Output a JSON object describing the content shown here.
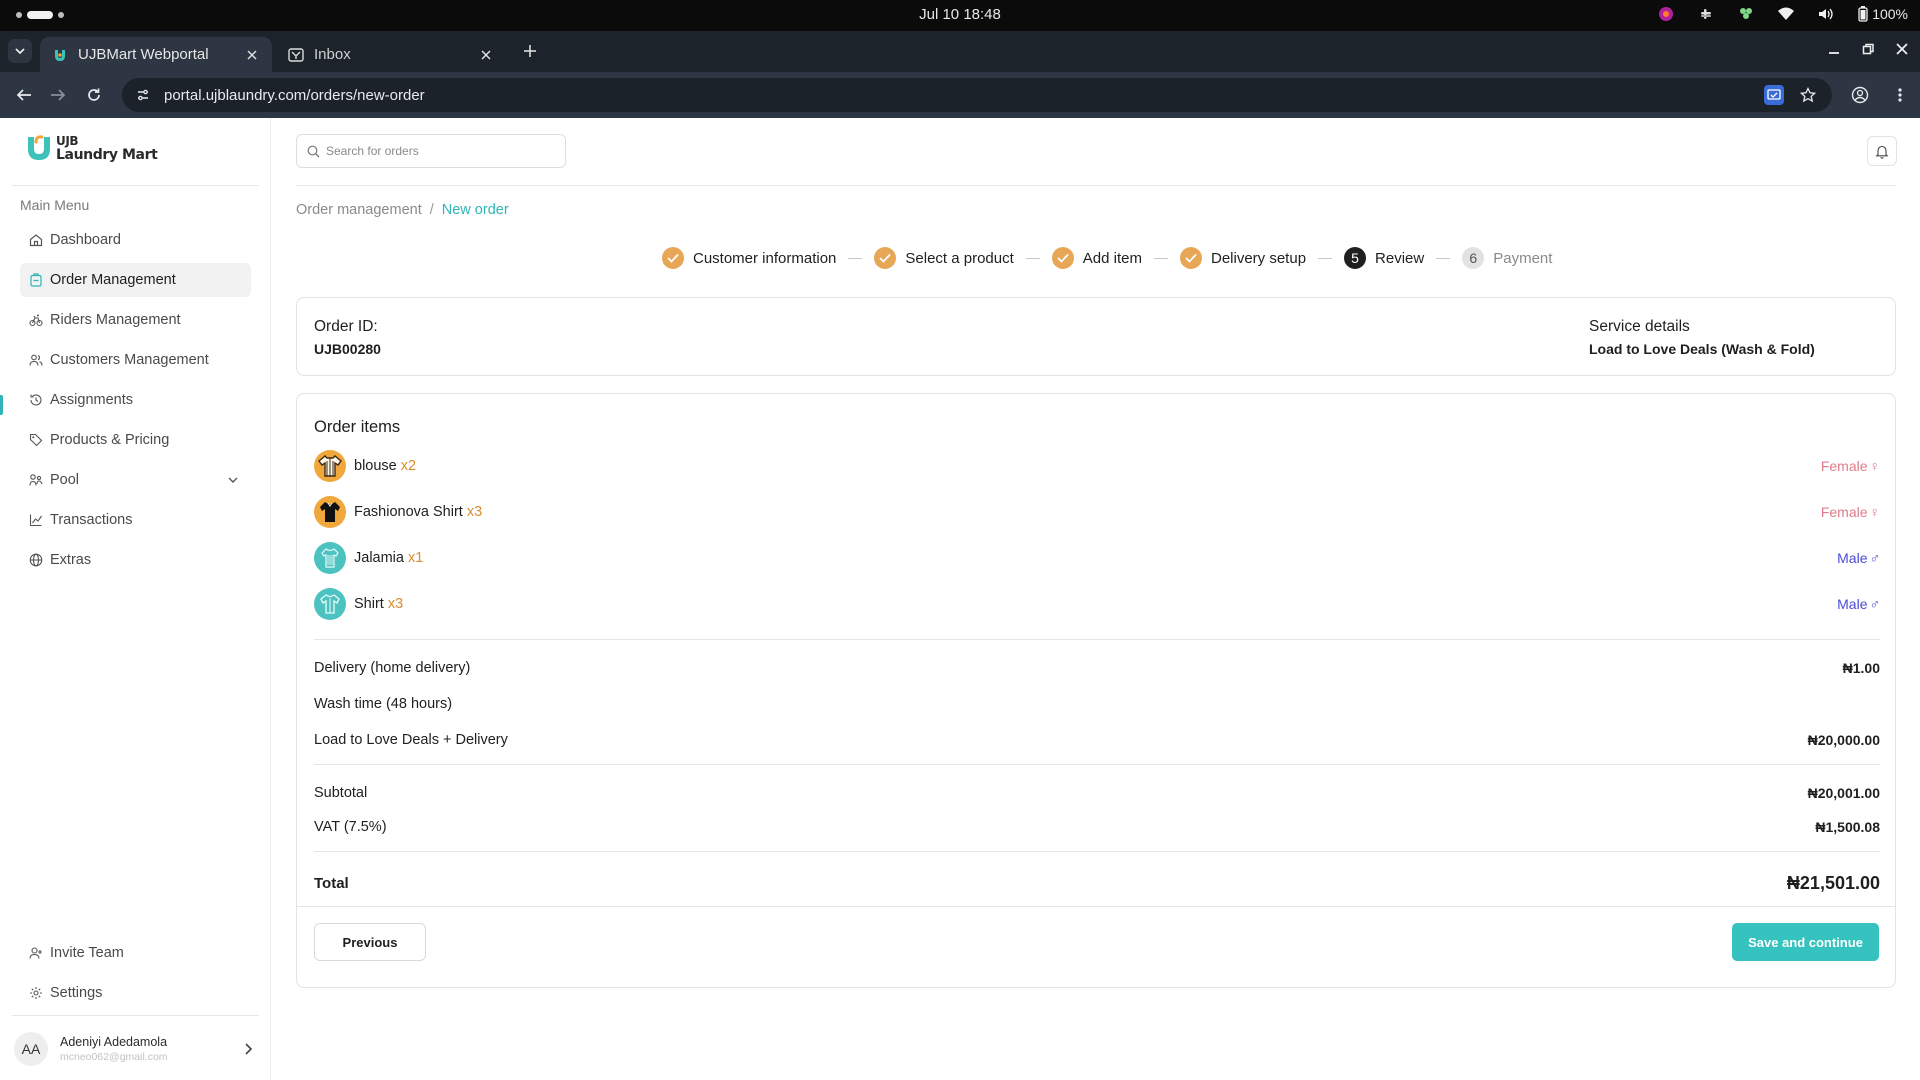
{
  "os": {
    "clock": "Jul 10  18:48",
    "battery": "100%"
  },
  "browser": {
    "tabs": [
      {
        "title": "UJBMart Webportal",
        "active": true
      },
      {
        "title": "Inbox",
        "active": false
      }
    ],
    "url": "portal.ujblaundry.com/orders/new-order"
  },
  "sidebar": {
    "logo": {
      "line1": "UJB",
      "line2": "Laundry Mart"
    },
    "menu_heading": "Main Menu",
    "items": [
      {
        "label": "Dashboard",
        "icon": "home-icon"
      },
      {
        "label": "Order Management",
        "icon": "clipboard-icon",
        "active": true
      },
      {
        "label": "Riders Management",
        "icon": "bike-icon"
      },
      {
        "label": "Customers Management",
        "icon": "users-icon"
      },
      {
        "label": "Assignments",
        "icon": "history-icon"
      },
      {
        "label": "Products & Pricing",
        "icon": "tag-icon"
      },
      {
        "label": "Pool",
        "icon": "pool-icon"
      },
      {
        "label": "Transactions",
        "icon": "chart-line-icon"
      },
      {
        "label": "Extras",
        "icon": "globe-icon"
      }
    ],
    "bottom": [
      {
        "label": "Invite Team",
        "icon": "user-plus-icon"
      },
      {
        "label": "Settings",
        "icon": "gear-icon"
      }
    ],
    "user": {
      "initials": "AA",
      "name": "Adeniyi Adedamola",
      "email": "mcneo062@gmail.com"
    }
  },
  "header": {
    "search_placeholder": "Search for orders"
  },
  "breadcrumb": {
    "root": "Order management",
    "sep": "/",
    "current": "New order"
  },
  "steps": [
    {
      "label": "Customer information",
      "status": "done"
    },
    {
      "label": "Select a product",
      "status": "done"
    },
    {
      "label": "Add item",
      "status": "done"
    },
    {
      "label": "Delivery setup",
      "status": "done"
    },
    {
      "label": "Review",
      "status": "current",
      "number": "5"
    },
    {
      "label": "Payment",
      "status": "todo",
      "number": "6"
    }
  ],
  "order": {
    "id_label": "Order ID:",
    "id_value": "UJB00280",
    "service_label": "Service details",
    "service_value": "Load to Love Deals (Wash & Fold)"
  },
  "items_title": "Order items",
  "items": [
    {
      "name": "blouse",
      "qty": "x2",
      "gender": "Female",
      "gender_symbol": "♀",
      "gender_class": "g-female"
    },
    {
      "name": "Fashionova Shirt",
      "qty": "x3",
      "gender": "Female",
      "gender_symbol": "♀",
      "gender_class": "g-female"
    },
    {
      "name": "Jalamia",
      "qty": "x1",
      "gender": "Male",
      "gender_symbol": "♂",
      "gender_class": "g-male"
    },
    {
      "name": "Shirt",
      "qty": "x3",
      "gender": "Male",
      "gender_symbol": "♂",
      "gender_class": "g-male"
    }
  ],
  "charges": {
    "delivery_label": "Delivery (home delivery)",
    "delivery_amount": "₦1.00",
    "wash_label": "Wash time (48 hours)",
    "deal_label": "Load to Love Deals + Delivery",
    "deal_amount": "₦20,000.00"
  },
  "summary": {
    "subtotal_label": "Subtotal",
    "subtotal_amount": "₦20,001.00",
    "vat_label": "VAT (7.5%)",
    "vat_amount": "₦1,500.08",
    "total_label": "Total",
    "total_amount": "₦21,501.00"
  },
  "buttons": {
    "previous": "Previous",
    "save": "Save and continue"
  },
  "colors": {
    "accent": "#36c2bf",
    "step_done": "#e8a657",
    "qty": "#d98e2d",
    "female": "#e07b8b",
    "male": "#4b4bd8"
  }
}
